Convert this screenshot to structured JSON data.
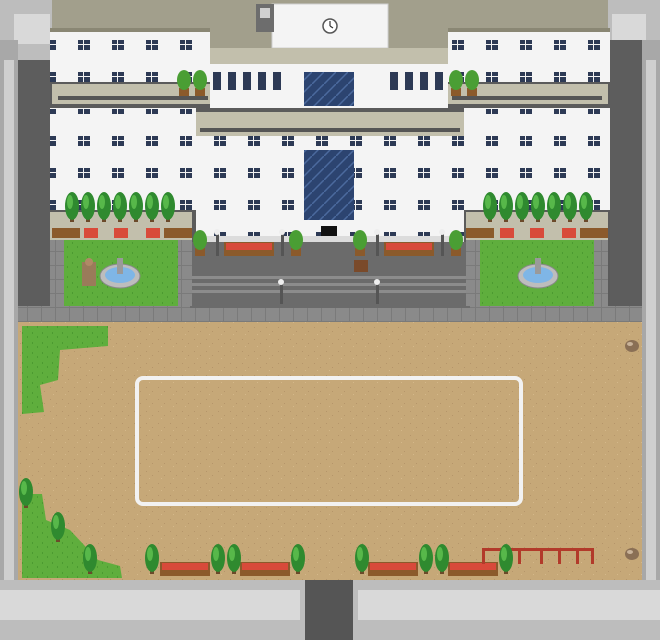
{
  "scene": {
    "title": "",
    "type": "rpg-map-school-courtyard",
    "colors": {
      "wall_outer": "#bdbdbd",
      "wall_inner": "#d9d9d9",
      "wall_edge": "#8f8f8f",
      "ground": "#c6a878",
      "ground_speck": "#b5956a",
      "grass": "#5fae3d",
      "grass_dark": "#3f8c2b",
      "building_white": "#f4f4f4",
      "building_shadow": "#dcdcdc",
      "roof": "#a29f8c",
      "roof_dark": "#8a8774",
      "window": "#2d3a55",
      "glass": "#2c4470",
      "pavement": "#6b6b6b",
      "pavement_light": "#8c8c8c",
      "court_line": "#f2f2f2",
      "tree": "#2f8a2f",
      "tree_light": "#57b84a",
      "flower_red": "#d84a3a",
      "fence": "#b23a2a",
      "water": "#7fb6e6"
    },
    "objects": {
      "buildings": [
        "school-building"
      ],
      "fountains": 2,
      "statue": 1,
      "bench_rows": 8,
      "court": "court-outline",
      "fence": "playground-fence",
      "entrance": "school-entrance"
    }
  }
}
